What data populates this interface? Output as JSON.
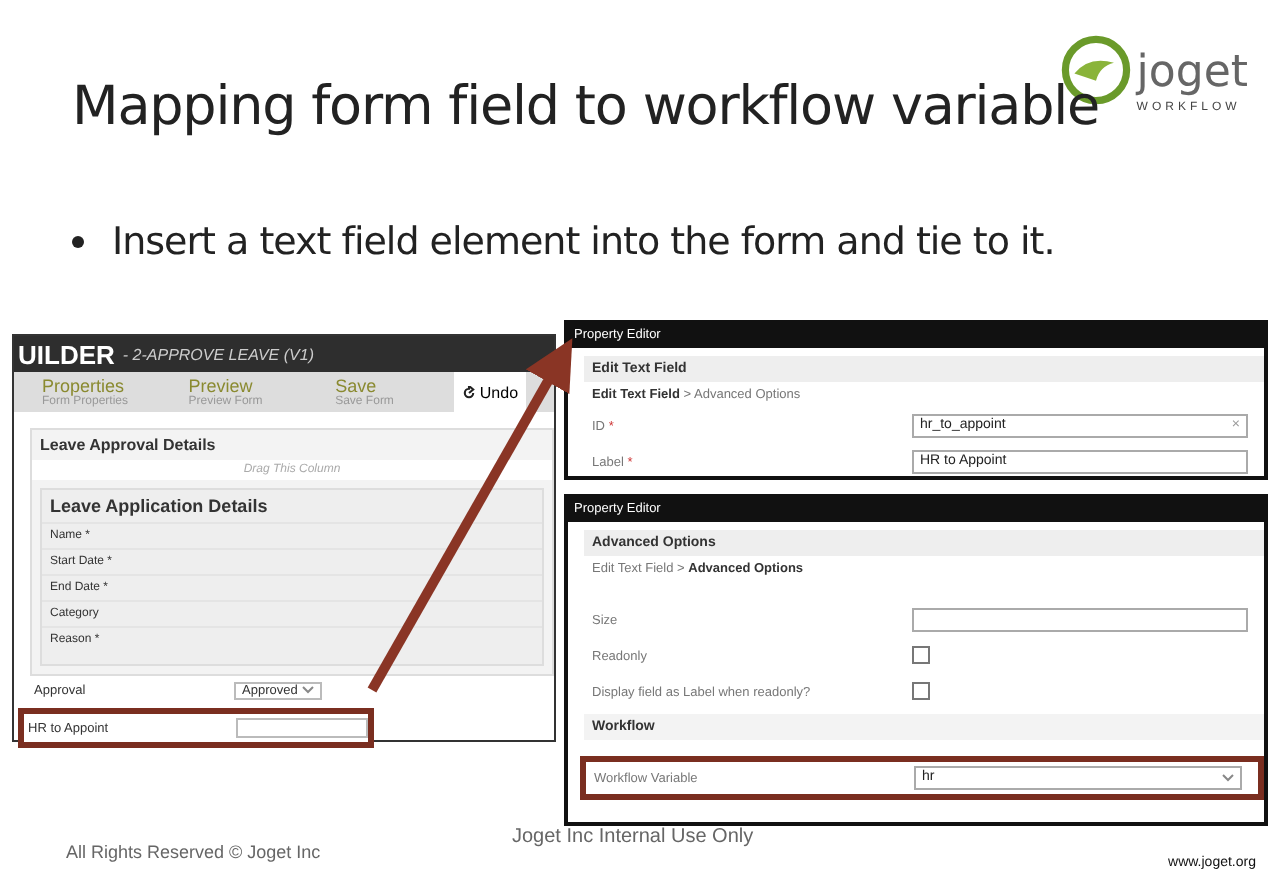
{
  "slide": {
    "title": "Mapping form field to workflow variable",
    "bullet": "Insert a text field element into the form and tie to it.",
    "logo": {
      "name": "joget",
      "tagline": "WORKFLOW"
    },
    "footer": {
      "left": "All Rights Reserved © Joget Inc",
      "center": "Joget Inc Internal Use Only",
      "right": "www.joget.org"
    }
  },
  "builder": {
    "title": "UILDER",
    "subtitle": "- 2-APPROVE LEAVE (V1)",
    "steps": [
      {
        "label": "Properties",
        "sub": "Form Properties"
      },
      {
        "label": "Preview",
        "sub": "Preview Form"
      },
      {
        "label": "Save",
        "sub": "Save Form"
      }
    ],
    "undo": "Undo",
    "section": "Leave Approval Details",
    "drag_hint": "Drag This Column",
    "subsection": "Leave Application Details",
    "fields": [
      "Name *",
      "Start Date *",
      "End Date *",
      "Category",
      "Reason *"
    ],
    "approval": {
      "label": "Approval",
      "value": "Approved"
    },
    "hr_field": {
      "label": "HR to Appoint"
    }
  },
  "editor_1": {
    "title": "Property Editor",
    "heading": "Edit Text Field",
    "crumb_current": "Edit Text Field",
    "crumb_next": "Advanced Options",
    "crumb_separator": ">",
    "rows": [
      {
        "label": "ID",
        "star": "*",
        "value": "hr_to_appoint",
        "clear": "×"
      },
      {
        "label": "Label",
        "star": "*",
        "value": "HR to Appoint"
      }
    ]
  },
  "editor_2": {
    "title": "Property Editor",
    "heading": "Advanced Options",
    "crumb_prev": "Edit Text Field",
    "crumb_separator": ">",
    "crumb_current": "Advanced Options",
    "rows": [
      {
        "kind": "text",
        "label": "Size"
      },
      {
        "kind": "checkbox",
        "label": "Readonly",
        "checked": false
      },
      {
        "kind": "checkbox",
        "label": "Display field as Label when readonly?",
        "checked": false
      }
    ],
    "workflow_heading": "Workflow",
    "workflow_variable": {
      "label": "Workflow Variable",
      "value": "hr"
    }
  }
}
